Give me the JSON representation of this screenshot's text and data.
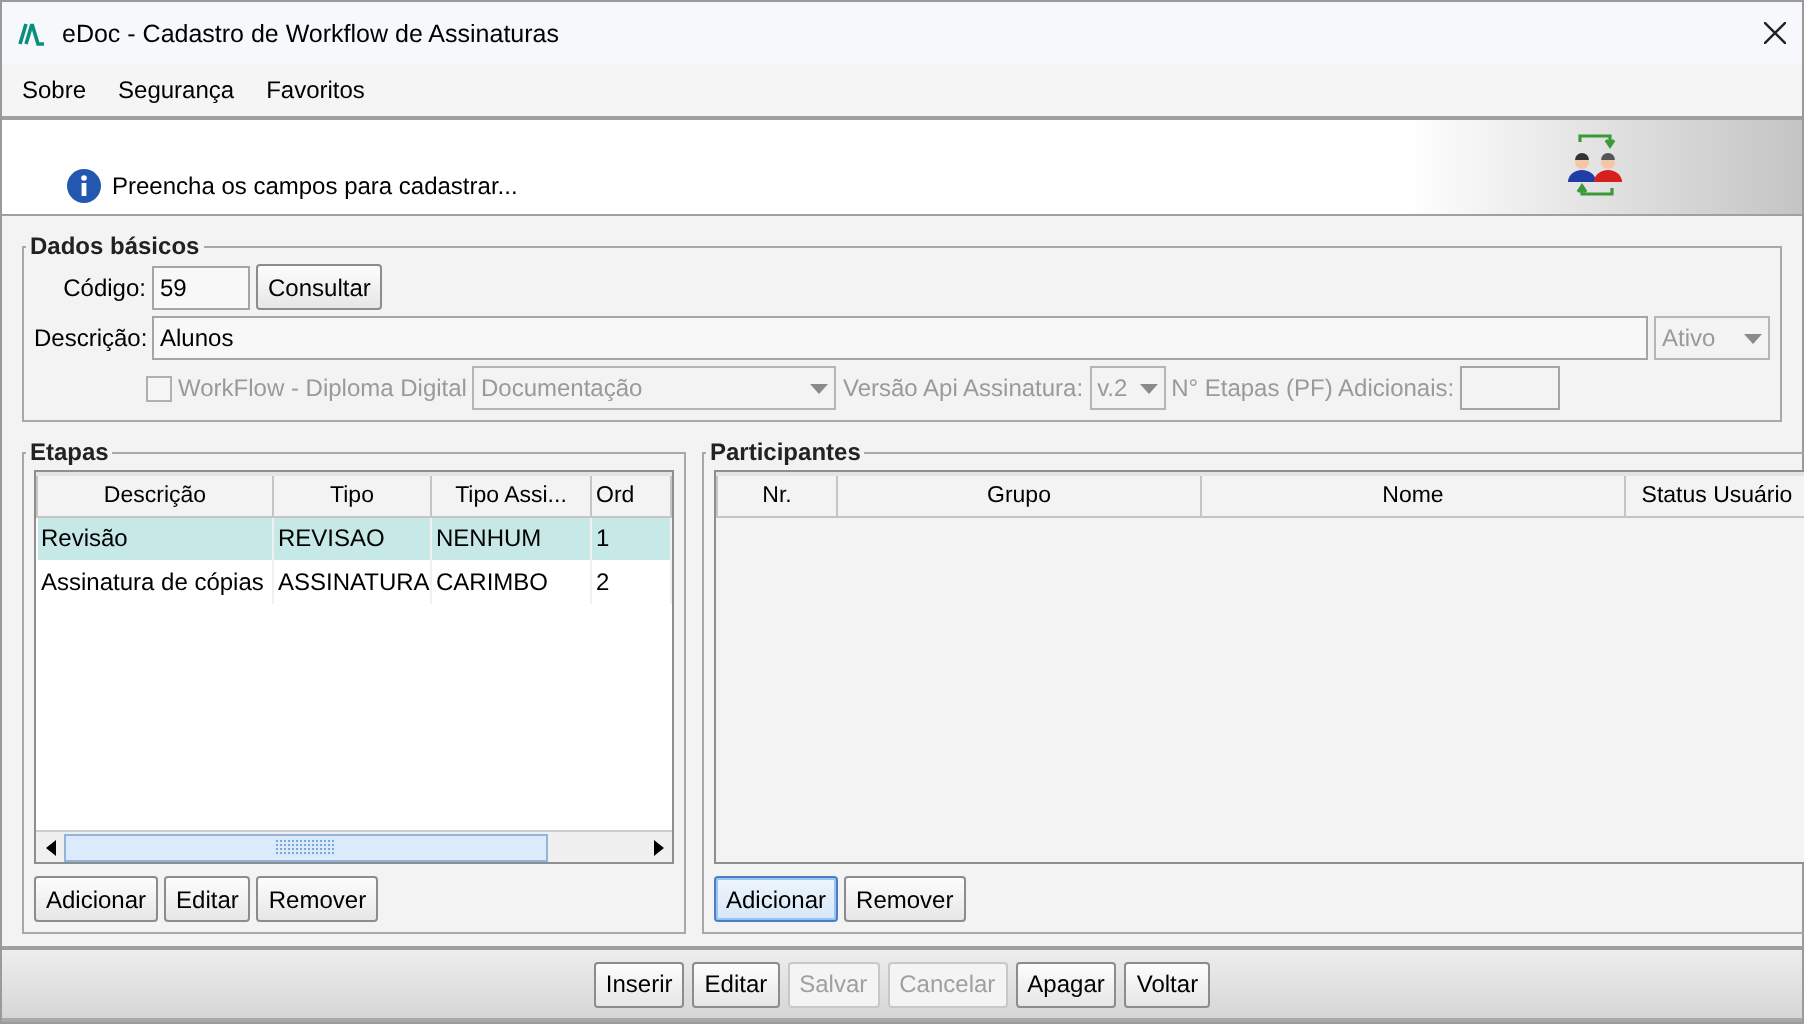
{
  "window": {
    "title": "eDoc - Cadastro de Workflow de Assinaturas"
  },
  "menu": [
    {
      "label": "Sobre"
    },
    {
      "label": "Segurança"
    },
    {
      "label": "Favoritos"
    }
  ],
  "banner": {
    "message": "Preencha os campos para cadastrar..."
  },
  "dados_basicos": {
    "legend": "Dados básicos",
    "codigo": {
      "label": "Código:",
      "value": "59"
    },
    "consultar": {
      "label": "Consultar"
    },
    "descricao": {
      "label": "Descrição:",
      "value": "Alunos"
    },
    "status": {
      "value": "Ativo",
      "disabled": true
    },
    "workflow": {
      "label": "WorkFlow - Diploma Digital",
      "checked": false,
      "disabled": true
    },
    "tipo_documento": {
      "value": "Documentação",
      "disabled": true
    },
    "versao": {
      "label": "Versão Api Assinatura:",
      "value": "v.2",
      "disabled": true
    },
    "etapas_pf": {
      "label": "N° Etapas (PF) Adicionais:",
      "disabled": true
    }
  },
  "etapas": {
    "legend": "Etapas",
    "columns": [
      "Descrição",
      "Tipo",
      "Tipo Assi...",
      "Ord"
    ],
    "rows": [
      {
        "cells": [
          "Revisão",
          "REVISAO",
          "NENHUM",
          "1"
        ],
        "selected": true
      },
      {
        "cells": [
          "Assinatura de cópias",
          "ASSINATURA",
          "CARIMBO",
          "2"
        ],
        "selected": false
      }
    ],
    "buttons": [
      {
        "label": "Adicionar",
        "focused": false
      },
      {
        "label": "Editar",
        "focused": false
      },
      {
        "label": "Remover",
        "focused": false
      }
    ]
  },
  "participantes": {
    "legend": "Participantes",
    "columns": [
      "Nr.",
      "Grupo",
      "Nome",
      "Status Usuário"
    ],
    "buttons": [
      {
        "label": "Adicionar",
        "focused": true
      },
      {
        "label": "Remover",
        "focused": false
      }
    ]
  },
  "actions": [
    {
      "label": "Inserir",
      "disabled": false
    },
    {
      "label": "Editar",
      "disabled": false
    },
    {
      "label": "Salvar",
      "disabled": true
    },
    {
      "label": "Cancelar",
      "disabled": true
    },
    {
      "label": "Apagar",
      "disabled": false
    },
    {
      "label": "Voltar",
      "disabled": false
    }
  ]
}
